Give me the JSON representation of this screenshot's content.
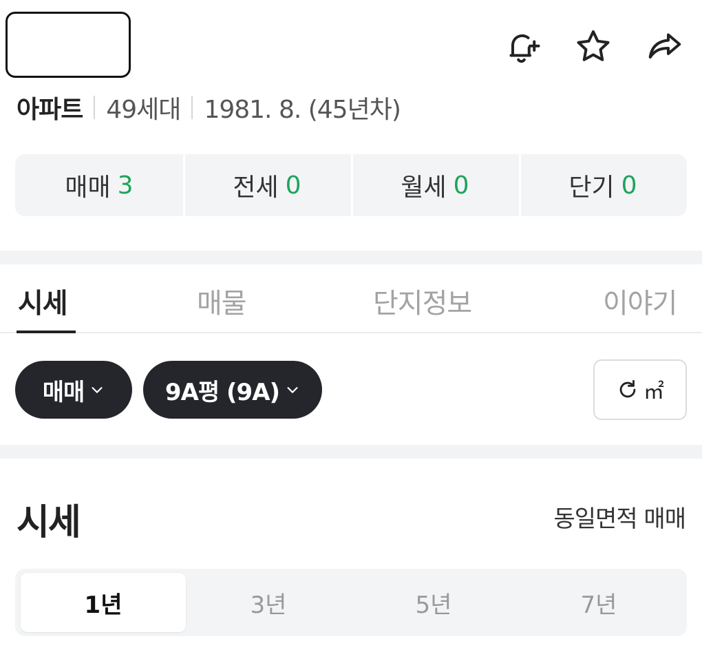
{
  "header": {
    "meta": {
      "type": "아파트",
      "households": "49세대",
      "built": "1981. 8. (45년차)"
    },
    "icons": [
      "bell-plus-icon",
      "star-icon",
      "share-icon"
    ]
  },
  "trade_summary": [
    {
      "label": "매매",
      "count": "3"
    },
    {
      "label": "전세",
      "count": "0"
    },
    {
      "label": "월세",
      "count": "0"
    },
    {
      "label": "단기",
      "count": "0"
    }
  ],
  "tabs": [
    {
      "label": "시세",
      "active": true
    },
    {
      "label": "매물",
      "active": false
    },
    {
      "label": "단지정보",
      "active": false
    },
    {
      "label": "이야기",
      "active": false
    }
  ],
  "filters": {
    "trade_type": "매매",
    "area": "9A평 (9A)",
    "unit_label": "㎡"
  },
  "section": {
    "title": "시세",
    "link": "동일면적 매매"
  },
  "periods": [
    {
      "label": "1년",
      "active": true
    },
    {
      "label": "3년",
      "active": false
    },
    {
      "label": "5년",
      "active": false
    },
    {
      "label": "7년",
      "active": false
    }
  ],
  "colors": {
    "count": "#1fa35a",
    "chip_bg": "#24262b",
    "panel_bg": "#f3f4f6"
  }
}
